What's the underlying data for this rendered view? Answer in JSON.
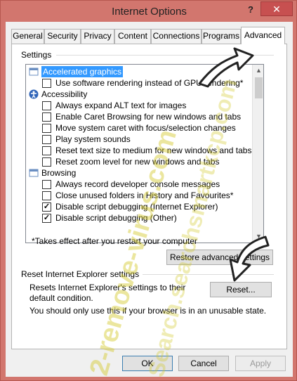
{
  "window": {
    "title": "Internet Options",
    "help_label": "?",
    "close_label": "✕"
  },
  "tabs": [
    {
      "label": "General",
      "active": false
    },
    {
      "label": "Security",
      "active": false
    },
    {
      "label": "Privacy",
      "active": false
    },
    {
      "label": "Content",
      "active": false
    },
    {
      "label": "Connections",
      "active": false
    },
    {
      "label": "Programs",
      "active": false
    },
    {
      "label": "Advanced",
      "active": true
    }
  ],
  "settings": {
    "group_label": "Settings",
    "rows": [
      {
        "kind": "category",
        "icon": "accelerated-graphics-icon",
        "label": "Accelerated graphics",
        "selected": true
      },
      {
        "kind": "option",
        "label": "Use software rendering instead of GPU rendering*",
        "checked": false
      },
      {
        "kind": "category",
        "icon": "accessibility-icon",
        "label": "Accessibility"
      },
      {
        "kind": "option",
        "label": "Always expand ALT text for images",
        "checked": false
      },
      {
        "kind": "option",
        "label": "Enable Caret Browsing for new windows and tabs",
        "checked": false
      },
      {
        "kind": "option",
        "label": "Move system caret with focus/selection changes",
        "checked": false
      },
      {
        "kind": "option",
        "label": "Play system sounds",
        "checked": false
      },
      {
        "kind": "option",
        "label": "Reset text size to medium for new windows and tabs",
        "checked": false
      },
      {
        "kind": "option",
        "label": "Reset zoom level for new windows and tabs",
        "checked": false
      },
      {
        "kind": "category",
        "icon": "browsing-icon",
        "label": "Browsing"
      },
      {
        "kind": "option",
        "label": "Always record developer console messages",
        "checked": false
      },
      {
        "kind": "option",
        "label": "Close unused folders in History and Favourites*",
        "checked": false
      },
      {
        "kind": "option",
        "label": "Disable script debugging (Internet Explorer)",
        "checked": true
      },
      {
        "kind": "option",
        "label": "Disable script debugging (Other)",
        "checked": true
      }
    ],
    "note": "*Takes effect after you restart your computer",
    "restore_button": "Restore advanced settings"
  },
  "reset_section": {
    "group_label": "Reset Internet Explorer settings",
    "description": "Resets Internet Explorer's settings to their default condition.",
    "reset_button": "Reset...",
    "warning": "You should only use this if your browser is in an unusable state."
  },
  "buttons": {
    "ok": "OK",
    "cancel": "Cancel",
    "apply": "Apply"
  },
  "watermark": {
    "primary": "2-remove-virus.com",
    "secondary": "Search.searchsmartkcp.com"
  },
  "colors": {
    "frame": "#d2766e",
    "selection": "#3399ff",
    "watermark": "#d2c828"
  }
}
